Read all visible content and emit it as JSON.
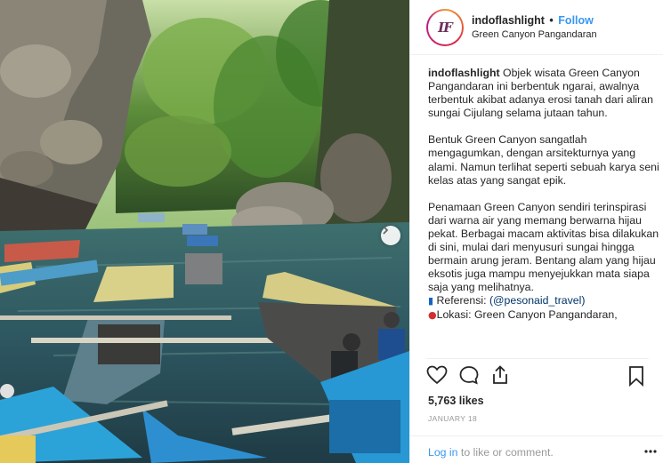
{
  "header": {
    "username": "indoflashlight",
    "separator": "•",
    "follow_label": "Follow",
    "location": "Green Canyon Pangandaran",
    "avatar_text": "IF"
  },
  "caption": {
    "username": "indoflashlight",
    "para1": "Objek wisata Green Canyon Pangandaran ini berbentuk ngarai, awalnya terbentuk akibat adanya erosi tanah dari aliran sungai Cijulang selama jutaan tahun.",
    "para2": "Bentuk Green Canyon sangatlah mengagumkan, dengan arsitekturnya yang alami. Namun terlihat seperti sebuah karya seni kelas atas yang sangat epik.",
    "para3": "Penamaan Green Canyon sendiri terinspirasi dari warna air yang memang berwarna hijau pekat. Berbagai macam aktivitas bisa dilakukan di sini, mulai dari menyusuri sungai hingga bermain arung jeram. Bentang alam yang hijau eksotis juga mampu menyejukkan mata siapa saja yang melihatnya.",
    "ref_label": "Referensi: ",
    "ref_link": "(@pesonaid_travel)",
    "loc_label": "Lokasi: Green Canyon Pangandaran,",
    "ref_emoji": "book-icon",
    "loc_emoji": "round-pushpin-icon"
  },
  "actions": {
    "like": "heart-icon",
    "comment": "comment-icon",
    "share": "share-icon",
    "save": "bookmark-icon"
  },
  "likes_text": "5,763 likes",
  "date_text": "JANUARY 18",
  "footer": {
    "login_label": "Log in",
    "rest_label": " to like or comment."
  },
  "colors": {
    "accent": "#3897f0",
    "link": "#003569",
    "muted": "#999999",
    "border": "#efefef"
  }
}
